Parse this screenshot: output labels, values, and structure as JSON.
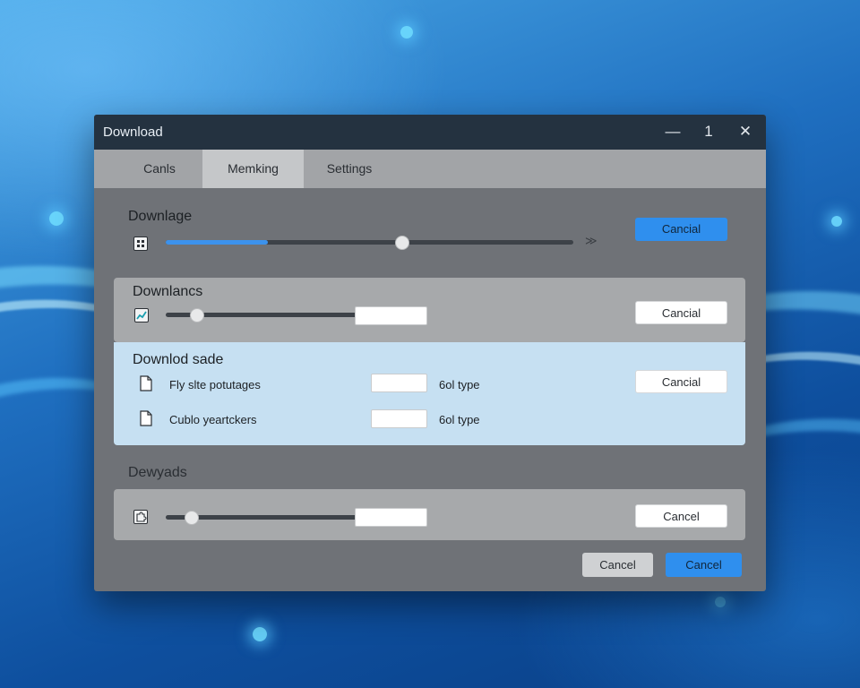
{
  "window": {
    "title": "Download",
    "controls": {
      "minimize": "—",
      "maximize": "1",
      "close": "✕"
    }
  },
  "tabs": [
    {
      "label": "Canls",
      "active": false
    },
    {
      "label": "Memking",
      "active": true
    },
    {
      "label": "Settings",
      "active": false
    }
  ],
  "section1": {
    "title": "Downlage",
    "progress": 0.25,
    "slider_value": 0.58,
    "end_glyph": "≫",
    "cancel_label": "Cancial"
  },
  "section2": {
    "title": "Downlancs",
    "slider_value": 0.12,
    "input_value": "",
    "cancel_label": "Cancial"
  },
  "section3": {
    "title": "Downlod sade",
    "rows": [
      {
        "name": "Fly slte potutages",
        "input_value": "",
        "type": "6ol type"
      },
      {
        "name": "Cublo yeartckers",
        "input_value": "",
        "type": "6ol type"
      }
    ],
    "cancel_label": "Cancial"
  },
  "section4": {
    "title": "Dewyads",
    "slider_value": 0.1,
    "input_value": "",
    "cancel_label": "Cancel"
  },
  "footer": {
    "cancel_label": "Cancel",
    "primary_label": "Cancel"
  },
  "colors": {
    "accent": "#2f8fee",
    "titlebar": "#243240",
    "highlight_panel": "#c6e0f2"
  },
  "icons": [
    "calculator-icon",
    "chart-icon",
    "document-icon",
    "puzzle-icon"
  ]
}
